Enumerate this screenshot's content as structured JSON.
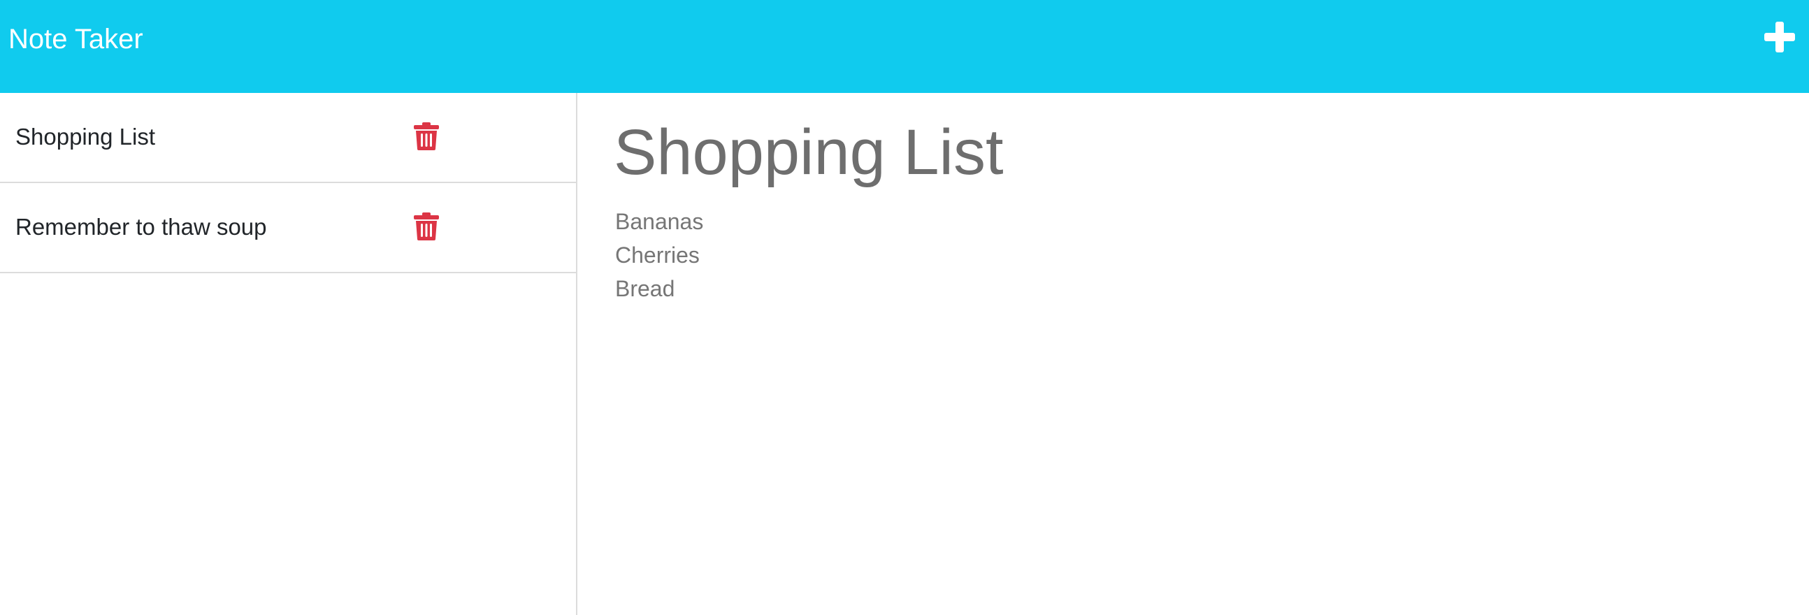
{
  "app": {
    "title": "Note Taker",
    "new_note_icon": "plus-icon",
    "accent_color": "#10cbee"
  },
  "sidebar": {
    "notes": [
      {
        "title": "Shopping List",
        "delete_icon": "trash-icon"
      },
      {
        "title": "Remember to thaw soup",
        "delete_icon": "trash-icon"
      }
    ],
    "delete_color": "#dc3545"
  },
  "editor": {
    "title": "Shopping List",
    "body_lines": [
      "Bananas",
      "Cherries",
      "Bread"
    ]
  }
}
